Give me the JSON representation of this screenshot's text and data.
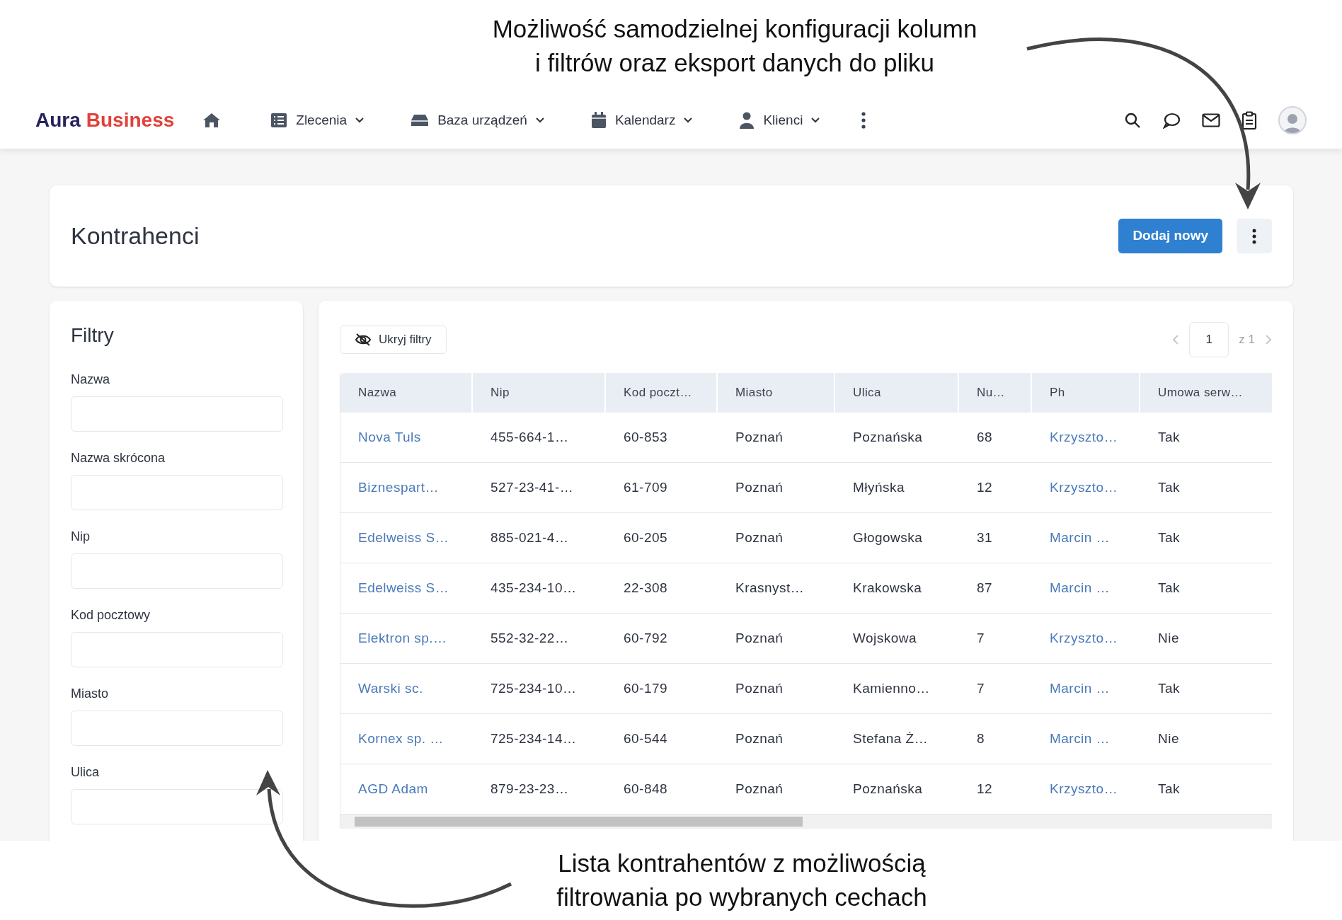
{
  "top_annotation": [
    "Możliwość samodzielnej konfiguracji kolumn",
    "i filtrów oraz eksport danych do pliku"
  ],
  "bottom_annotation": [
    "Lista kontrahentów z możliwością",
    "filtrowania po wybranych cechach"
  ],
  "nav": {
    "logo": [
      "Aura",
      "Business"
    ],
    "menu": [
      {
        "label": "Zlecenia",
        "kind": "list"
      },
      {
        "label": "Baza urządzeń",
        "kind": "device"
      },
      {
        "label": "Kalendarz",
        "kind": "calendar"
      },
      {
        "label": "Klienci",
        "kind": "user"
      }
    ]
  },
  "page": {
    "title": "Kontrahenci",
    "add_button": "Dodaj nowy"
  },
  "filters": {
    "title": "Filtry",
    "fields": [
      {
        "label": "Nazwa"
      },
      {
        "label": "Nazwa skrócona"
      },
      {
        "label": "Nip"
      },
      {
        "label": "Kod pocztowy"
      },
      {
        "label": "Miasto"
      },
      {
        "label": "Ulica"
      }
    ]
  },
  "toolbar": {
    "hide_filters": "Ukryj filtry",
    "page": "1",
    "page_total": "z 1"
  },
  "table": {
    "columns": [
      {
        "label": "Nazwa",
        "link": true
      },
      {
        "label": "Nip",
        "link": false
      },
      {
        "label": "Kod poczt…",
        "link": false
      },
      {
        "label": "Miasto",
        "link": false
      },
      {
        "label": "Ulica",
        "link": false
      },
      {
        "label": "Nu…",
        "link": false
      },
      {
        "label": "Ph",
        "link": true
      },
      {
        "label": "Umowa serw…",
        "link": false
      }
    ],
    "rows": [
      [
        "Nova Tuls",
        "455-664-1…",
        "60-853",
        "Poznań",
        "Poznańska",
        "68",
        "Krzyszto…",
        "Tak"
      ],
      [
        "Biznespart…",
        "527-23-41-…",
        "61-709",
        "Poznań",
        "Młyńska",
        "12",
        "Krzyszto…",
        "Tak"
      ],
      [
        "Edelweiss S…",
        "885-021-4…",
        "60-205",
        "Poznań",
        "Głogowska",
        "31",
        "Marcin …",
        "Tak"
      ],
      [
        "Edelweiss S…",
        "435-234-10…",
        "22-308",
        "Krasnyst…",
        "Krakowska",
        "87",
        "Marcin …",
        "Tak"
      ],
      [
        "Elektron sp.…",
        "552-32-22…",
        "60-792",
        "Poznań",
        "Wojskowa",
        "7",
        "Krzyszto…",
        "Nie"
      ],
      [
        "Warski sc.",
        "725-234-10…",
        "60-179",
        "Poznań",
        "Kamienno…",
        "7",
        "Marcin …",
        "Tak"
      ],
      [
        "Kornex sp. …",
        "725-234-14…",
        "60-544",
        "Poznań",
        "Stefana Ż…",
        "8",
        "Marcin …",
        "Nie"
      ],
      [
        "AGD Adam",
        "879-23-23…",
        "60-848",
        "Poznań",
        "Poznańska",
        "12",
        "Krzyszto…",
        "Tak"
      ]
    ]
  }
}
